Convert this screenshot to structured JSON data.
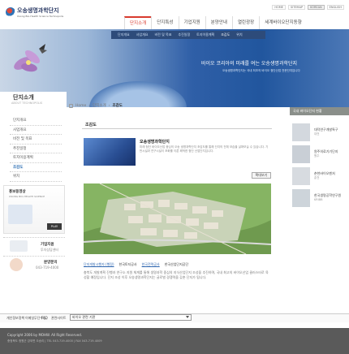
{
  "header": {
    "logo_text": "오송생명과학단지",
    "logo_sub": "Osong Bio-Health Science Technopolis",
    "util": [
      "HOME",
      "SITEMAP",
      "KOREAN",
      "ENGLISH"
    ],
    "gnb": [
      "단지소개",
      "단지특성",
      "기업지원",
      "분양안내",
      "열린광장",
      "세계바이오단지동향"
    ],
    "subnav": [
      "단지개요",
      "사업개요",
      "비전 및 목표",
      "추진일정",
      "토지이용계획",
      "조감도",
      "위치"
    ]
  },
  "hero": {
    "slogan": "바이오 코리아의 미래를 여는 오송생명과학단지",
    "sub": "오송생명과학단지는 국내 최초의 바이오 첨단산업 전문단지입니다"
  },
  "sidebar": {
    "title": "단지소개",
    "title_en": "ABOUT TECHNOPOLIS",
    "items": [
      "단지개요",
      "사업개요",
      "비전 및 목표",
      "추진일정",
      "토지이용계획",
      "조감도",
      "위치"
    ],
    "promo1": {
      "title": "홍보동영상",
      "sub": "OSONG BIO-HEALTH SCIENCE",
      "button": "PLAY"
    },
    "promo2": {
      "label": "기업지원",
      "sub": "투자상담센터"
    },
    "promo3": {
      "label": "분양문의",
      "sub": "043-719-4000"
    }
  },
  "breadcrumb": [
    "Home",
    "단지소개",
    "조감도"
  ],
  "content": {
    "title": "조감도",
    "org_name": "오송생명과학단지",
    "org_desc": "미래 첨단 바이오산업 중심의 오송 생명과학단지 조감도를 통해 단지의 전체 모습을 살펴보실 수 있습니다. 기반시설과 연구시설이 조화를 이룬 쾌적한 첨단 산업단지입니다.",
    "zoom_label": "확대보기",
    "links": [
      "단지개발시행자 (행정)",
      "한국토지공사",
      "한국전력공사",
      "한국산업단지공단"
    ],
    "body": "충북도 개발계획 진행과 연구소 지원 체계를 통해 생명과학 중심의 지식산업단지 조성을 추진하며, 국내 최고의 바이오산업 클러스터로 육성할 예정입니다. 단지 조성 이후 오송생명과학단지는 글로벌 경쟁력을 갖춘 단지가 됩니다."
  },
  "right": {
    "title": "국내 바이오단지 현황",
    "items": [
      {
        "title": "대덕연구개발특구",
        "sub": "대전"
      },
      {
        "title": "원주의료기기단지",
        "sub": "원주"
      },
      {
        "title": "춘천바이오벤처",
        "sub": "춘천"
      },
      {
        "title": "한국생명공학연구원",
        "sub": "KRIBB"
      }
    ]
  },
  "footer": {
    "nav": [
      "개인정보정책",
      "이메일무단수집",
      "FAQ",
      "관련사이트"
    ],
    "select": "바이오 관련 기관",
    "copyright": "Copyright 2006 by MOHW. All Right Reserved.",
    "address": "충청북도 청원군 강외면 오송리 | TEL 043-719-4000 | FAX 043-719-4009"
  }
}
